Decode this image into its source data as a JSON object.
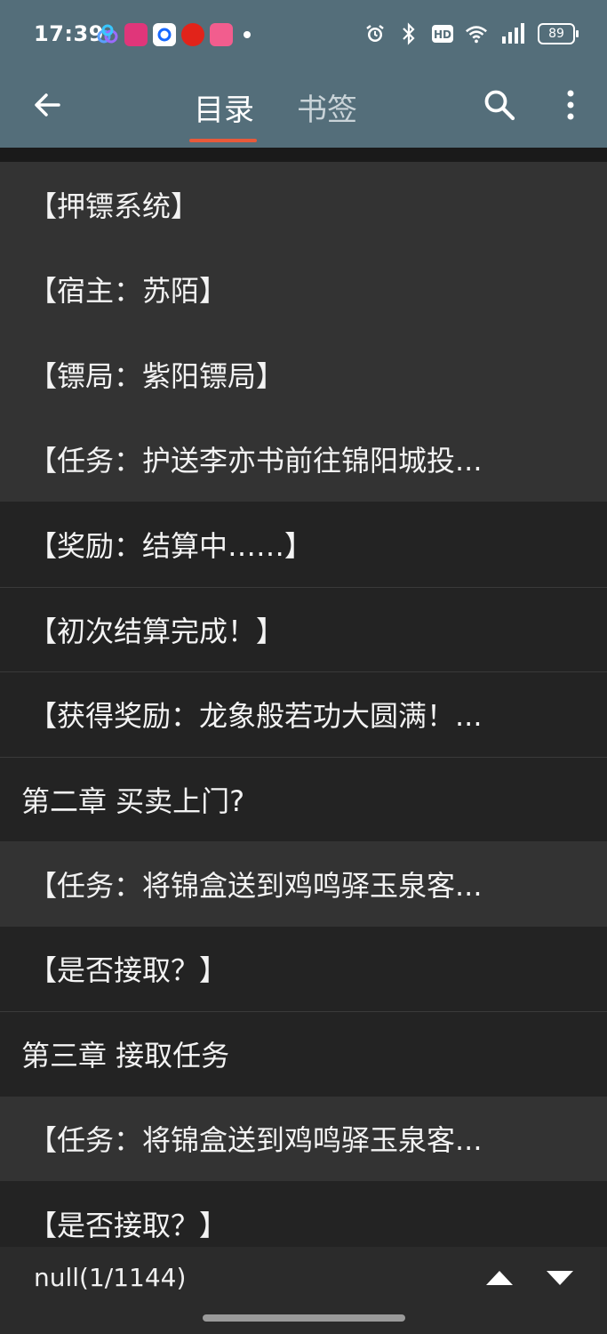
{
  "status_bar": {
    "time": "17:39",
    "battery": "89",
    "app_icons": [
      {
        "name": "cloud-app-icon",
        "color": "#4a8cf7"
      },
      {
        "name": "tv-app-icon",
        "color": "#e0367a"
      },
      {
        "name": "circle-app-icon",
        "color": "#1769ff"
      },
      {
        "name": "jd-app-icon",
        "color": "#e2231a"
      },
      {
        "name": "bilibili-app-icon",
        "color": "#f25d8e"
      }
    ],
    "indicators": [
      "alarm-icon",
      "bluetooth-icon",
      "hd-icon",
      "wifi-icon",
      "signal-5g-icon"
    ]
  },
  "appbar": {
    "tabs": [
      {
        "label": "目录",
        "active": true
      },
      {
        "label": "书签",
        "active": false
      }
    ],
    "accent_color": "#e8593a",
    "background_color": "#546e7a"
  },
  "toc": {
    "items": [
      {
        "label": "【押镖系统】",
        "kind": "entry",
        "highlight": true
      },
      {
        "label": "【宿主：苏陌】",
        "kind": "entry",
        "highlight": true
      },
      {
        "label": "【镖局：紫阳镖局】",
        "kind": "entry",
        "highlight": true
      },
      {
        "label": "【任务：护送李亦书前往锦阳城投...",
        "kind": "entry",
        "highlight": true
      },
      {
        "label": "【奖励：结算中……】",
        "kind": "entry",
        "highlight": false
      },
      {
        "label": "【初次结算完成！】",
        "kind": "entry",
        "highlight": false
      },
      {
        "label": "【获得奖励：龙象般若功大圆满！...",
        "kind": "entry",
        "highlight": false
      },
      {
        "label": "第二章 买卖上门?",
        "kind": "chapter",
        "highlight": false
      },
      {
        "label": "【任务：将锦盒送到鸡鸣驿玉泉客...",
        "kind": "entry",
        "highlight": true
      },
      {
        "label": "【是否接取？】",
        "kind": "entry",
        "highlight": false
      },
      {
        "label": "第三章 接取任务",
        "kind": "chapter",
        "highlight": false
      },
      {
        "label": "【任务：将锦盒送到鸡鸣驿玉泉客...",
        "kind": "entry",
        "highlight": true
      },
      {
        "label": "【是否接取？】",
        "kind": "entry",
        "highlight": false
      }
    ]
  },
  "bottom_bar": {
    "position_text": "null(1/1144)"
  }
}
